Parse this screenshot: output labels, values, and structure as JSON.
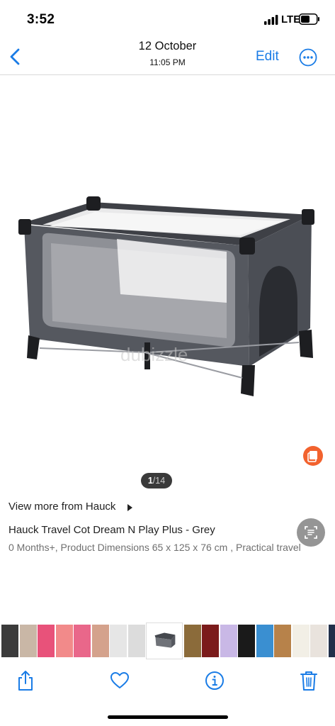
{
  "status_bar": {
    "time": "3:52",
    "network": "LTE"
  },
  "nav": {
    "title": "12 October",
    "subtitle": "11:05 PM",
    "edit_label": "Edit"
  },
  "photo": {
    "pager_current": "1",
    "pager_total": "14",
    "watermark": "dubizzle"
  },
  "listing": {
    "view_more": "View more from Hauck",
    "title": "Hauck Travel Cot Dream N Play Plus - Grey",
    "description": "0 Months+, Product Dimensions 65 x 125 x 76 cm , Practical travel"
  },
  "thumbnails": [
    {
      "color": "#3b3b3b"
    },
    {
      "color": "#c9b7a6"
    },
    {
      "color": "#e8527a"
    },
    {
      "color": "#f28a8a"
    },
    {
      "color": "#e9678a"
    },
    {
      "color": "#d4a28c"
    },
    {
      "color": "#e6e6e6"
    },
    {
      "color": "#dcdcdc"
    },
    {
      "color": "#ffffff",
      "selected": true
    },
    {
      "color": "#8b6b3a"
    },
    {
      "color": "#7b1b1b"
    },
    {
      "color": "#c9b8e6"
    },
    {
      "color": "#1a1a1a"
    },
    {
      "color": "#3a8fd1"
    },
    {
      "color": "#b7824a"
    },
    {
      "color": "#f2efe6"
    },
    {
      "color": "#e9e3dd"
    },
    {
      "color": "#22304a"
    }
  ],
  "colors": {
    "accent": "#1a7ce6",
    "badge": "#f2622e"
  },
  "toolbar_icons": [
    "share-icon",
    "heart-icon",
    "info-icon",
    "trash-icon"
  ]
}
